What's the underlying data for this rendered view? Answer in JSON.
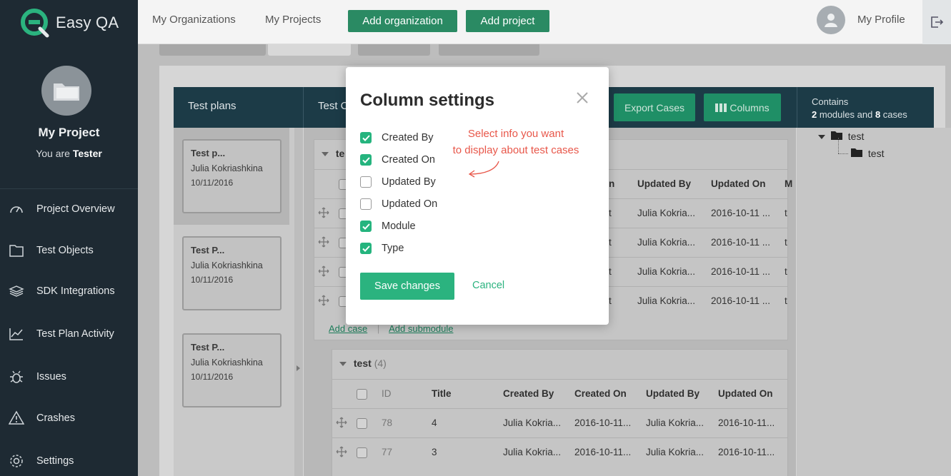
{
  "app": {
    "name": "Easy QA"
  },
  "sidebar": {
    "project_name": "My Project",
    "role_prefix": "You are",
    "role": "Tester",
    "items": [
      {
        "label": "Project Overview",
        "icon": "speedometer-icon"
      },
      {
        "label": "Test Objects",
        "icon": "folder-icon"
      },
      {
        "label": "SDK Integrations",
        "icon": "layers-icon"
      },
      {
        "label": "Test Plan Activity",
        "icon": "chart-line-icon"
      },
      {
        "label": "Issues",
        "icon": "bug-icon"
      },
      {
        "label": "Crashes",
        "icon": "warning-icon"
      },
      {
        "label": "Settings",
        "icon": "gear-icon"
      }
    ]
  },
  "topbar": {
    "my_organizations": "My Organizations",
    "my_projects": "My Projects",
    "add_organization": "Add organization",
    "add_project": "Add project",
    "my_profile": "My Profile"
  },
  "colors": {
    "sidebar": "#1e2a33",
    "accent": "#2bb37f",
    "header": "#1c3b47",
    "hint": "#e8574a"
  },
  "header": {
    "test_plans": "Test plans",
    "test_cases_partial": "Test C",
    "export_cases": "Export Cases",
    "columns": "Columns",
    "contains_label": "Contains",
    "modules_count": "2",
    "modules_text": "modules and",
    "cases_count": "8",
    "cases_text": "cases"
  },
  "plans": [
    {
      "title": "Test p...",
      "author": "Julia Kokriashkina",
      "date": "10/11/2016"
    },
    {
      "title": "Test P...",
      "author": "Julia Kokriashkina",
      "date": "10/11/2016"
    },
    {
      "title": "Test P...",
      "author": "Julia Kokriashkina",
      "date": "10/11/2016"
    }
  ],
  "module1": {
    "title": "te",
    "headers": [
      "n",
      "Updated By",
      "Updated On",
      "M"
    ],
    "rows": [
      {
        "c1": "t",
        "updated_by": "Julia Kokria...",
        "updated_on": "2016-10-11 ...",
        "m": "t"
      },
      {
        "c1": "t",
        "updated_by": "Julia Kokria...",
        "updated_on": "2016-10-11 ...",
        "m": "t"
      },
      {
        "c1": "t",
        "updated_by": "Julia Kokria...",
        "updated_on": "2016-10-11 ...",
        "m": "t"
      },
      {
        "c1": "t",
        "updated_by": "Julia Kokria...",
        "updated_on": "2016-10-11 ...",
        "m": "t"
      }
    ],
    "add_case": "Add case",
    "add_submodule": "Add submodule"
  },
  "module2": {
    "title": "test",
    "count": "(4)",
    "headers": [
      "ID",
      "Title",
      "Created By",
      "Created On",
      "Updated By",
      "Updated On"
    ],
    "rows": [
      {
        "id": "78",
        "title": "4",
        "created_by": "Julia Kokria...",
        "created_on": "2016-10-11...",
        "updated_by": "Julia Kokria...",
        "updated_on": "2016-10-11..."
      },
      {
        "id": "77",
        "title": "3",
        "created_by": "Julia Kokria...",
        "created_on": "2016-10-11...",
        "updated_by": "Julia Kokria...",
        "updated_on": "2016-10-11..."
      }
    ]
  },
  "tree": {
    "root": "test",
    "child": "test"
  },
  "modal": {
    "title": "Column settings",
    "options": [
      {
        "label": "Created By",
        "checked": true
      },
      {
        "label": "Created On",
        "checked": true
      },
      {
        "label": "Updated By",
        "checked": false
      },
      {
        "label": "Updated On",
        "checked": false
      },
      {
        "label": "Module",
        "checked": true
      },
      {
        "label": "Type",
        "checked": true
      }
    ],
    "save": "Save changes",
    "cancel": "Cancel",
    "hint_line1": "Select info you want",
    "hint_line2": "to display about test cases"
  }
}
